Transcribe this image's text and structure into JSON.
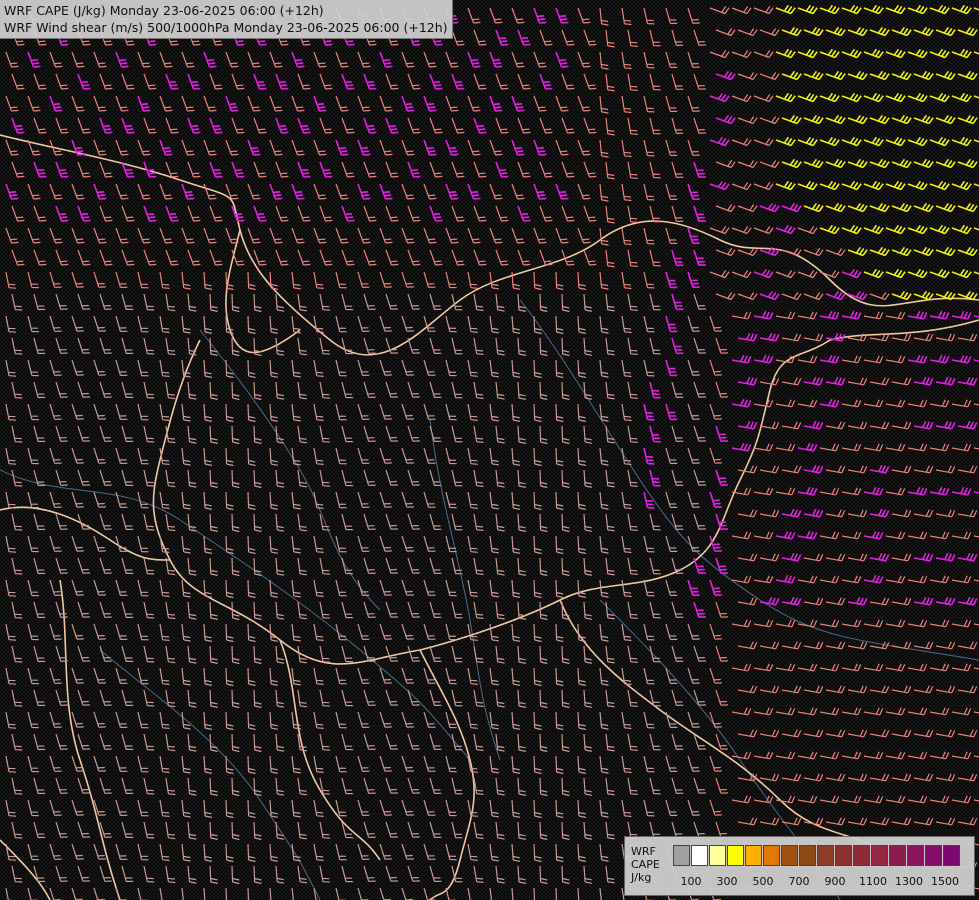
{
  "header": {
    "line1": "WRF CAPE (J/kg) Monday 23-06-2025 06:00 (+12h)",
    "line2": "WRF Wind shear (m/s) 500/1000hPa Monday 23-06-2025 06:00 (+12h)"
  },
  "legend": {
    "title_line1": "WRF",
    "title_line2": "CAPE",
    "title_line3": "J/kg",
    "colors": [
      "#a0a0a0",
      "#ffffff",
      "#ffff99",
      "#ffff00",
      "#ffb000",
      "#e07800",
      "#a05010",
      "#8a4a18",
      "#8e3c26",
      "#8c3030",
      "#902a3a",
      "#962646",
      "#8c1c50",
      "#8a1460",
      "#860c6a",
      "#7e0870"
    ],
    "ticks": [
      "100",
      "300",
      "500",
      "700",
      "900",
      "1100",
      "1300",
      "1500"
    ]
  },
  "colors": {
    "border": "#f0c8a0",
    "river": "#5a7fb0",
    "shear_low": "#c89a96",
    "shear_mid": "#e8837a",
    "shear_high": "#e020e0",
    "shear_max": "#f0f000"
  }
}
